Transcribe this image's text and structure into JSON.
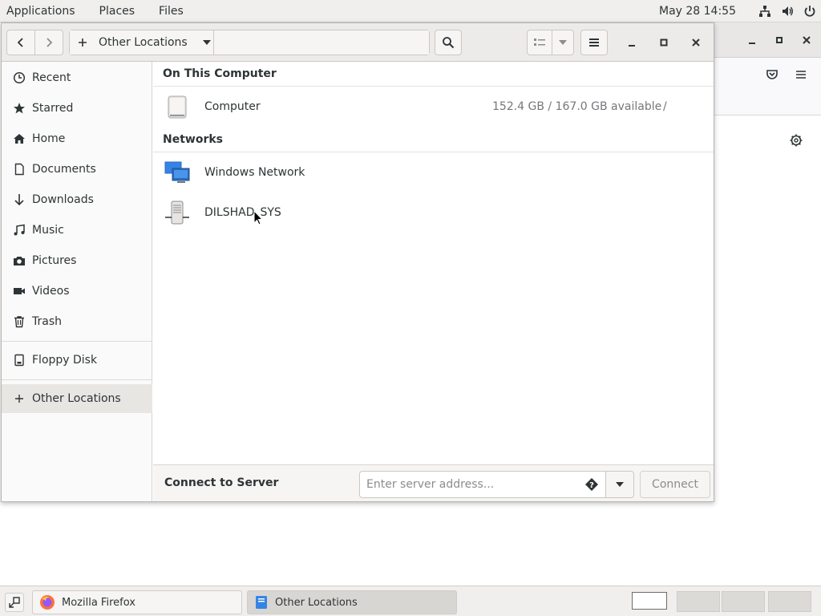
{
  "top_panel": {
    "menus": [
      "Applications",
      "Places",
      "Files"
    ],
    "clock": "May 28  14:55"
  },
  "headerbar": {
    "location_label": "Other Locations",
    "icons": [
      "go-back-icon",
      "go-forward-icon",
      "new-folder-plus-icon",
      "menu-chevron-down-icon",
      "search-icon",
      "list-view-icon",
      "view-options-chevron-icon",
      "hamburger-menu-icon",
      "minimize-icon",
      "maximize-icon",
      "close-icon"
    ]
  },
  "sidebar": {
    "items": [
      {
        "label": "Recent",
        "icon": "recent-clock-icon"
      },
      {
        "label": "Starred",
        "icon": "star-icon"
      },
      {
        "label": "Home",
        "icon": "home-icon"
      },
      {
        "label": "Documents",
        "icon": "document-icon"
      },
      {
        "label": "Downloads",
        "icon": "download-arrow-icon"
      },
      {
        "label": "Music",
        "icon": "music-note-icon"
      },
      {
        "label": "Pictures",
        "icon": "camera-icon"
      },
      {
        "label": "Videos",
        "icon": "video-camera-icon"
      },
      {
        "label": "Trash",
        "icon": "trash-icon"
      }
    ],
    "devices": [
      {
        "label": "Floppy Disk",
        "icon": "disk-icon"
      }
    ],
    "other": {
      "label": "Other Locations",
      "icon": "plus-icon"
    }
  },
  "main": {
    "sections": [
      {
        "header": "On This Computer",
        "rows": [
          {
            "name": "Computer",
            "info": "152.4 GB / 167.0 GB available",
            "path": "/",
            "icon": "hard-drive-icon"
          }
        ]
      },
      {
        "header": "Networks",
        "rows": [
          {
            "name": "Windows Network",
            "info": "",
            "path": "",
            "icon": "network-computers-icon"
          },
          {
            "name": "DILSHAD_SYS",
            "info": "",
            "path": "",
            "icon": "network-server-icon"
          }
        ]
      }
    ]
  },
  "connect_bar": {
    "label": "Connect to Server",
    "placeholder": "Enter server address...",
    "connect_label": "Connect"
  },
  "taskbar": {
    "tasks": [
      {
        "label": "Mozilla Firefox",
        "icon": "firefox-icon",
        "active": false
      },
      {
        "label": "Other Locations",
        "icon": "files-icon",
        "active": true
      }
    ]
  },
  "colors": {
    "accent_blue": "#3584e4",
    "firefox_orange": "#ff7139"
  }
}
